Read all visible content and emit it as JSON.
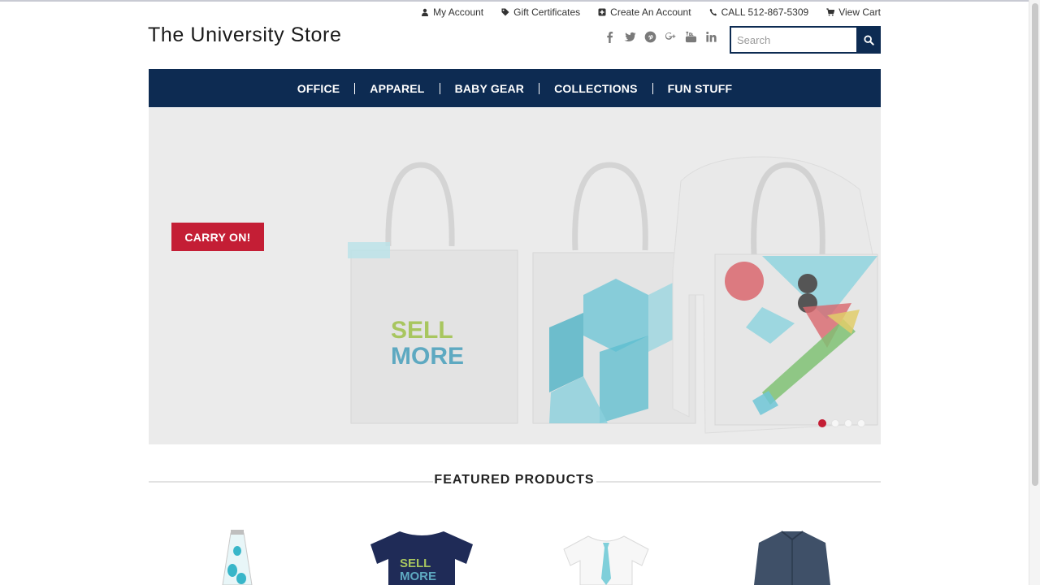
{
  "utility_links": [
    {
      "icon": "user-icon",
      "label": "My Account"
    },
    {
      "icon": "tag-icon",
      "label": "Gift Certificates"
    },
    {
      "icon": "plus-square-icon",
      "label": "Create An Account"
    },
    {
      "icon": "phone-icon",
      "label": "CALL 512-867-5309"
    },
    {
      "icon": "cart-icon",
      "label": "View Cart"
    }
  ],
  "store_title": "The University Store",
  "social_icons": [
    "facebook-icon",
    "twitter-icon",
    "pinterest-icon",
    "google-plus-icon",
    "youtube-icon",
    "linkedin-icon"
  ],
  "search": {
    "placeholder": "Search"
  },
  "nav": [
    "OFFICE",
    "APPAREL",
    "BABY GEAR",
    "COLLECTIONS",
    "FUN STUFF"
  ],
  "hero": {
    "button_label": "CARRY ON!",
    "art_text_line1": "SELL",
    "art_text_line2": "MORE",
    "slide_count": 4,
    "active_slide": 1
  },
  "featured": {
    "title": "FEATURED PRODUCTS"
  },
  "products": [
    {
      "name": "lava-lamp"
    },
    {
      "name": "navy-tshirt",
      "print_line1": "SELL",
      "print_line2": "MORE"
    },
    {
      "name": "baby-onesie-tie"
    },
    {
      "name": "denim-shirt"
    }
  ],
  "colors": {
    "navy": "#0d2b52",
    "red": "#c41e35",
    "teal": "#5fc4d3",
    "hero_bg": "#ebebeb"
  }
}
